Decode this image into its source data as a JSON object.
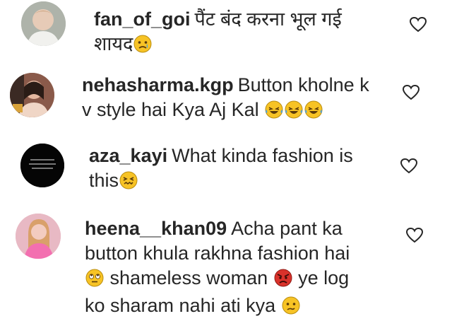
{
  "comments": [
    {
      "username": "fan_of_goi",
      "text_line1": "पैंट बंद करना भूल गई",
      "text_line2": "शायद",
      "emojis": [
        "sad-tear-emoji"
      ]
    },
    {
      "username": "nehasharma.kgp",
      "text_line1": "Button kholne k",
      "text_line2": "v style hai Kya Aj Kal",
      "emojis": [
        "laughing-tears-emoji",
        "laughing-tears-emoji",
        "laughing-tears-emoji"
      ]
    },
    {
      "username": "aza_kayi",
      "text_line1": "What kinda fashion is",
      "text_line2": "this",
      "emojis": [
        "confounded-emoji"
      ]
    },
    {
      "username": "heena__khan09",
      "text_line1": "Acha pant ka",
      "text_line2": "button khula rakhna fashion hai",
      "text_line3_a": "shameless woman",
      "text_line3_b": "ye log",
      "text_line4": "ko sharam nahi ati kya",
      "emojis": [
        "eye-roll-emoji",
        "angry-face-emoji",
        "confused-face-emoji"
      ]
    }
  ],
  "colors": {
    "text": "#262626",
    "heart_stroke": "#262626",
    "emoji_yellow": "#f7c325",
    "emoji_red": "#d9322b"
  }
}
